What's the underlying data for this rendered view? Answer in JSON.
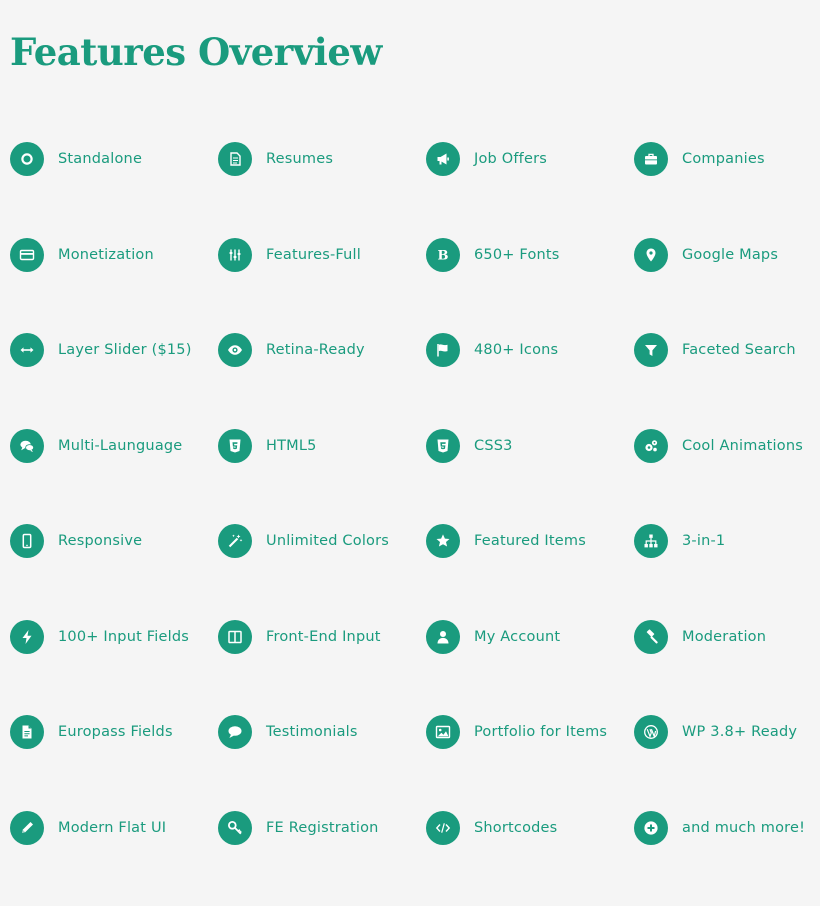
{
  "title": "Features Overview",
  "accent_color": "#1a9b7e",
  "features": [
    {
      "label": "Standalone",
      "icon": "circle-outline-icon"
    },
    {
      "label": "Resumes",
      "icon": "document-icon"
    },
    {
      "label": "Job Offers",
      "icon": "megaphone-icon"
    },
    {
      "label": "Companies",
      "icon": "briefcase-icon"
    },
    {
      "label": "Monetization",
      "icon": "credit-card-icon"
    },
    {
      "label": "Features-Full",
      "icon": "sliders-icon"
    },
    {
      "label": "650+ Fonts",
      "icon": "bold-b-icon"
    },
    {
      "label": "Google Maps",
      "icon": "map-pin-icon"
    },
    {
      "label": "Layer Slider ($15)",
      "icon": "horizontal-arrows-icon"
    },
    {
      "label": "Retina-Ready",
      "icon": "eye-icon"
    },
    {
      "label": "480+ Icons",
      "icon": "flag-icon"
    },
    {
      "label": "Faceted Search",
      "icon": "filter-icon"
    },
    {
      "label": "Multi-Launguage",
      "icon": "chat-bubbles-icon"
    },
    {
      "label": "HTML5",
      "icon": "html5-icon"
    },
    {
      "label": "CSS3",
      "icon": "css3-icon"
    },
    {
      "label": "Cool Animations",
      "icon": "gears-icon"
    },
    {
      "label": "Responsive",
      "icon": "mobile-icon"
    },
    {
      "label": "Unlimited Colors",
      "icon": "magic-wand-icon"
    },
    {
      "label": "Featured Items",
      "icon": "star-icon"
    },
    {
      "label": "3-in-1",
      "icon": "sitemap-icon"
    },
    {
      "label": "100+ Input Fields",
      "icon": "lightning-icon"
    },
    {
      "label": "Front-End Input",
      "icon": "columns-icon"
    },
    {
      "label": "My Account",
      "icon": "user-icon"
    },
    {
      "label": "Moderation",
      "icon": "gavel-icon"
    },
    {
      "label": "Europass Fields",
      "icon": "file-text-icon"
    },
    {
      "label": "Testimonials",
      "icon": "speech-bubble-icon"
    },
    {
      "label": "Portfolio for Items",
      "icon": "picture-icon"
    },
    {
      "label": "WP 3.8+ Ready",
      "icon": "wordpress-icon"
    },
    {
      "label": "Modern Flat UI",
      "icon": "pencil-icon"
    },
    {
      "label": "FE Registration",
      "icon": "key-icon"
    },
    {
      "label": "Shortcodes",
      "icon": "code-icon"
    },
    {
      "label": "and much more!",
      "icon": "plus-circle-icon"
    }
  ]
}
